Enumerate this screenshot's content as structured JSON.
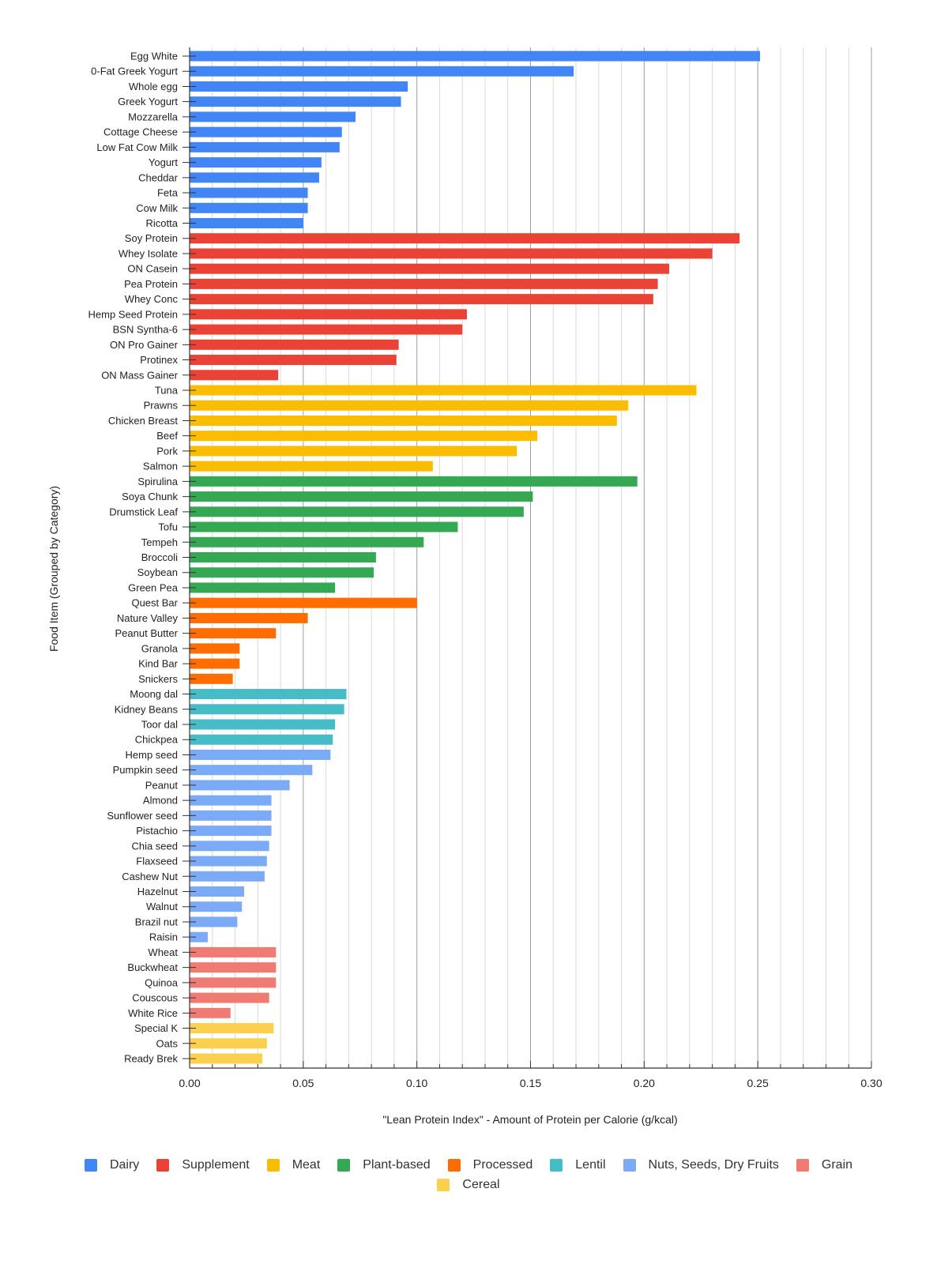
{
  "chart_data": {
    "type": "bar",
    "orientation": "horizontal",
    "title": "",
    "xlabel": "\"Lean Protein Index\" - Amount of Protein per Calorie (g/kcal)",
    "ylabel": "Food Item (Grouped by Category)",
    "xlim": [
      0,
      0.3
    ],
    "x_ticks": [
      "0.00",
      "0.05",
      "0.10",
      "0.15",
      "0.20",
      "0.25",
      "0.30"
    ],
    "x_tick_values": [
      0,
      0.05,
      0.1,
      0.15,
      0.2,
      0.25,
      0.3
    ],
    "minor_grid_step": 0.01,
    "grid": true,
    "legend_position": "bottom",
    "categories_legend": [
      {
        "name": "Dairy",
        "color": "#4285F4"
      },
      {
        "name": "Supplement",
        "color": "#EA4335"
      },
      {
        "name": "Meat",
        "color": "#FBBC04"
      },
      {
        "name": "Plant-based",
        "color": "#34A853"
      },
      {
        "name": "Processed",
        "color": "#FF6D01"
      },
      {
        "name": "Lentil",
        "color": "#46BDC6"
      },
      {
        "name": "Nuts, Seeds, Dry Fruits",
        "color": "#7BAAF7"
      },
      {
        "name": "Grain",
        "color": "#F07B72"
      },
      {
        "name": "Cereal",
        "color": "#FCD04F"
      }
    ],
    "items": [
      {
        "label": "Egg White",
        "group": "Dairy",
        "value": 0.251
      },
      {
        "label": "0-Fat Greek Yogurt",
        "group": "Dairy",
        "value": 0.169
      },
      {
        "label": "Whole egg",
        "group": "Dairy",
        "value": 0.096
      },
      {
        "label": "Greek Yogurt",
        "group": "Dairy",
        "value": 0.093
      },
      {
        "label": "Mozzarella",
        "group": "Dairy",
        "value": 0.073
      },
      {
        "label": "Cottage Cheese",
        "group": "Dairy",
        "value": 0.067
      },
      {
        "label": "Low Fat Cow Milk",
        "group": "Dairy",
        "value": 0.066
      },
      {
        "label": "Yogurt",
        "group": "Dairy",
        "value": 0.058
      },
      {
        "label": "Cheddar",
        "group": "Dairy",
        "value": 0.057
      },
      {
        "label": "Feta",
        "group": "Dairy",
        "value": 0.052
      },
      {
        "label": "Cow Milk",
        "group": "Dairy",
        "value": 0.052
      },
      {
        "label": "Ricotta",
        "group": "Dairy",
        "value": 0.05
      },
      {
        "label": "Soy Protein",
        "group": "Supplement",
        "value": 0.242
      },
      {
        "label": "Whey Isolate",
        "group": "Supplement",
        "value": 0.23
      },
      {
        "label": "ON Casein",
        "group": "Supplement",
        "value": 0.211
      },
      {
        "label": "Pea Protein",
        "group": "Supplement",
        "value": 0.206
      },
      {
        "label": "Whey Conc",
        "group": "Supplement",
        "value": 0.204
      },
      {
        "label": "Hemp Seed Protein",
        "group": "Supplement",
        "value": 0.122
      },
      {
        "label": "BSN Syntha-6",
        "group": "Supplement",
        "value": 0.12
      },
      {
        "label": "ON Pro Gainer",
        "group": "Supplement",
        "value": 0.092
      },
      {
        "label": "Protinex",
        "group": "Supplement",
        "value": 0.091
      },
      {
        "label": "ON Mass Gainer",
        "group": "Supplement",
        "value": 0.039
      },
      {
        "label": "Tuna",
        "group": "Meat",
        "value": 0.223
      },
      {
        "label": "Prawns",
        "group": "Meat",
        "value": 0.193
      },
      {
        "label": "Chicken Breast",
        "group": "Meat",
        "value": 0.188
      },
      {
        "label": "Beef",
        "group": "Meat",
        "value": 0.153
      },
      {
        "label": "Pork",
        "group": "Meat",
        "value": 0.144
      },
      {
        "label": "Salmon",
        "group": "Meat",
        "value": 0.107
      },
      {
        "label": "Spirulina",
        "group": "Plant-based",
        "value": 0.197
      },
      {
        "label": "Soya Chunk",
        "group": "Plant-based",
        "value": 0.151
      },
      {
        "label": "Drumstick Leaf",
        "group": "Plant-based",
        "value": 0.147
      },
      {
        "label": "Tofu",
        "group": "Plant-based",
        "value": 0.118
      },
      {
        "label": "Tempeh",
        "group": "Plant-based",
        "value": 0.103
      },
      {
        "label": "Broccoli",
        "group": "Plant-based",
        "value": 0.082
      },
      {
        "label": "Soybean",
        "group": "Plant-based",
        "value": 0.081
      },
      {
        "label": "Green Pea",
        "group": "Plant-based",
        "value": 0.064
      },
      {
        "label": "Quest Bar",
        "group": "Processed",
        "value": 0.1
      },
      {
        "label": "Nature Valley",
        "group": "Processed",
        "value": 0.052
      },
      {
        "label": "Peanut Butter",
        "group": "Processed",
        "value": 0.038
      },
      {
        "label": "Granola",
        "group": "Processed",
        "value": 0.022
      },
      {
        "label": "Kind Bar",
        "group": "Processed",
        "value": 0.022
      },
      {
        "label": "Snickers",
        "group": "Processed",
        "value": 0.019
      },
      {
        "label": "Moong dal",
        "group": "Lentil",
        "value": 0.069
      },
      {
        "label": "Kidney Beans",
        "group": "Lentil",
        "value": 0.068
      },
      {
        "label": "Toor dal",
        "group": "Lentil",
        "value": 0.064
      },
      {
        "label": "Chickpea",
        "group": "Lentil",
        "value": 0.063
      },
      {
        "label": "Hemp seed",
        "group": "Nuts, Seeds, Dry Fruits",
        "value": 0.062
      },
      {
        "label": "Pumpkin seed",
        "group": "Nuts, Seeds, Dry Fruits",
        "value": 0.054
      },
      {
        "label": "Peanut",
        "group": "Nuts, Seeds, Dry Fruits",
        "value": 0.044
      },
      {
        "label": "Almond",
        "group": "Nuts, Seeds, Dry Fruits",
        "value": 0.036
      },
      {
        "label": "Sunflower seed",
        "group": "Nuts, Seeds, Dry Fruits",
        "value": 0.036
      },
      {
        "label": "Pistachio",
        "group": "Nuts, Seeds, Dry Fruits",
        "value": 0.036
      },
      {
        "label": "Chia seed",
        "group": "Nuts, Seeds, Dry Fruits",
        "value": 0.035
      },
      {
        "label": "Flaxseed",
        "group": "Nuts, Seeds, Dry Fruits",
        "value": 0.034
      },
      {
        "label": "Cashew Nut",
        "group": "Nuts, Seeds, Dry Fruits",
        "value": 0.033
      },
      {
        "label": "Hazelnut",
        "group": "Nuts, Seeds, Dry Fruits",
        "value": 0.024
      },
      {
        "label": "Walnut",
        "group": "Nuts, Seeds, Dry Fruits",
        "value": 0.023
      },
      {
        "label": "Brazil nut",
        "group": "Nuts, Seeds, Dry Fruits",
        "value": 0.021
      },
      {
        "label": "Raisin",
        "group": "Nuts, Seeds, Dry Fruits",
        "value": 0.008
      },
      {
        "label": "Wheat",
        "group": "Grain",
        "value": 0.038
      },
      {
        "label": "Buckwheat",
        "group": "Grain",
        "value": 0.038
      },
      {
        "label": "Quinoa",
        "group": "Grain",
        "value": 0.038
      },
      {
        "label": "Couscous",
        "group": "Grain",
        "value": 0.035
      },
      {
        "label": "White Rice",
        "group": "Grain",
        "value": 0.018
      },
      {
        "label": "Special K",
        "group": "Cereal",
        "value": 0.037
      },
      {
        "label": "Oats",
        "group": "Cereal",
        "value": 0.034
      },
      {
        "label": "Ready Brek",
        "group": "Cereal",
        "value": 0.032
      }
    ]
  }
}
